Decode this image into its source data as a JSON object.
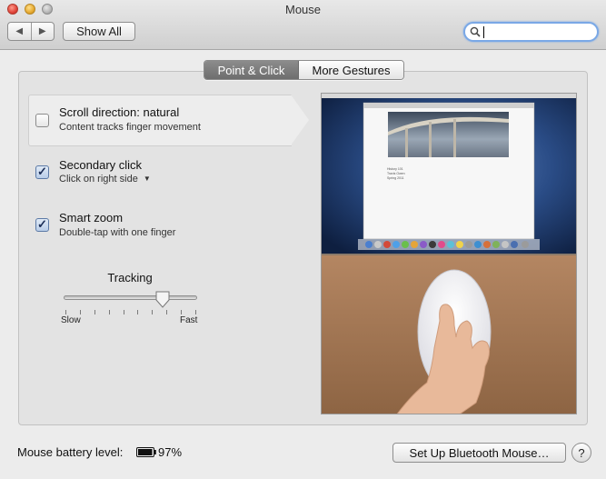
{
  "window": {
    "title": "Mouse"
  },
  "toolbar": {
    "show_all_label": "Show All",
    "back_icon": "back-arrow-icon",
    "forward_icon": "forward-arrow-icon",
    "search_placeholder": ""
  },
  "tabs": [
    {
      "label": "Point & Click",
      "selected": true
    },
    {
      "label": "More Gestures",
      "selected": false
    }
  ],
  "options": [
    {
      "title": "Scroll direction: natural",
      "subtitle": "Content tracks finger movement",
      "checked": false
    },
    {
      "title": "Secondary click",
      "subtitle": "Click on right side",
      "checked": true,
      "has_dropdown": true
    },
    {
      "title": "Smart zoom",
      "subtitle": "Double-tap with one finger",
      "checked": true
    }
  ],
  "tracking": {
    "label": "Tracking",
    "min_label": "Slow",
    "max_label": "Fast",
    "tick_count": 10,
    "value_fraction": 0.75
  },
  "preview": {
    "doc_lines": [
      "History 101",
      "Travis Owen",
      "Spring 2011"
    ],
    "colors": {
      "desktop": "#2a4c86",
      "table": "#a97a55"
    }
  },
  "footer": {
    "battery_label": "Mouse battery level:",
    "battery_value": "97%",
    "battery_fraction": 0.97,
    "bluetooth_button": "Set Up Bluetooth Mouse…",
    "help_label": "?"
  }
}
